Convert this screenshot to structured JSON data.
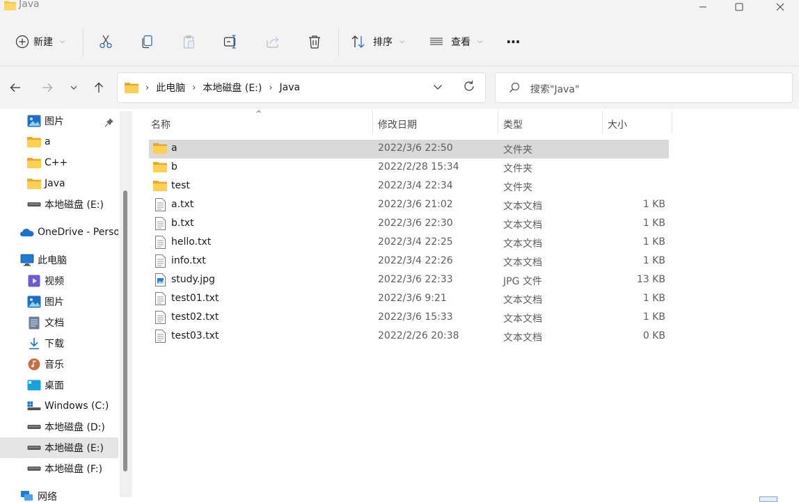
{
  "window": {
    "title": "Java"
  },
  "toolbar": {
    "new_label": "新建",
    "sort_label": "排序",
    "view_label": "查看",
    "more_label": "···"
  },
  "address": {
    "crumbs": [
      "此电脑",
      "本地磁盘 (E:)",
      "Java"
    ],
    "search_placeholder": "搜索\"Java\""
  },
  "sidebar": {
    "items": [
      {
        "label": "图片",
        "icon": "pictures-icon",
        "pinned": true
      },
      {
        "label": "a",
        "icon": "folder-icon"
      },
      {
        "label": "C++",
        "icon": "folder-icon"
      },
      {
        "label": "Java",
        "icon": "folder-icon"
      },
      {
        "label": "本地磁盘 (E:)",
        "icon": "drive-icon"
      },
      {
        "label": "OneDrive - Perso",
        "icon": "onedrive-icon"
      },
      {
        "label": "此电脑",
        "icon": "this-pc-icon"
      },
      {
        "label": "视频",
        "icon": "videos-icon"
      },
      {
        "label": "图片",
        "icon": "pictures-icon"
      },
      {
        "label": "文档",
        "icon": "documents-icon"
      },
      {
        "label": "下载",
        "icon": "downloads-icon"
      },
      {
        "label": "音乐",
        "icon": "music-icon"
      },
      {
        "label": "桌面",
        "icon": "desktop-icon"
      },
      {
        "label": "Windows (C:)",
        "icon": "windows-drive-icon"
      },
      {
        "label": "本地磁盘 (D:)",
        "icon": "drive-icon"
      },
      {
        "label": "本地磁盘 (E:)",
        "icon": "drive-icon",
        "selected": true
      },
      {
        "label": "本地磁盘 (F:)",
        "icon": "drive-icon"
      },
      {
        "label": "网络",
        "icon": "network-icon"
      }
    ]
  },
  "columns": {
    "name": "名称",
    "date": "修改日期",
    "type": "类型",
    "size": "大小"
  },
  "files": [
    {
      "name": "a",
      "date": "2022/3/6 22:50",
      "type": "文件夹",
      "size": "",
      "icon": "folder-icon",
      "selected": true
    },
    {
      "name": "b",
      "date": "2022/2/28 15:34",
      "type": "文件夹",
      "size": "",
      "icon": "folder-icon"
    },
    {
      "name": "test",
      "date": "2022/3/4 22:34",
      "type": "文件夹",
      "size": "",
      "icon": "folder-icon"
    },
    {
      "name": "a.txt",
      "date": "2022/3/6 21:02",
      "type": "文本文档",
      "size": "1 KB",
      "icon": "text-file-icon"
    },
    {
      "name": "b.txt",
      "date": "2022/3/6 22:30",
      "type": "文本文档",
      "size": "1 KB",
      "icon": "text-file-icon"
    },
    {
      "name": "hello.txt",
      "date": "2022/3/4 22:25",
      "type": "文本文档",
      "size": "1 KB",
      "icon": "text-file-icon"
    },
    {
      "name": "info.txt",
      "date": "2022/3/4 22:26",
      "type": "文本文档",
      "size": "1 KB",
      "icon": "text-file-icon"
    },
    {
      "name": "study.jpg",
      "date": "2022/3/6 22:33",
      "type": "JPG 文件",
      "size": "13 KB",
      "icon": "image-file-icon"
    },
    {
      "name": "test01.txt",
      "date": "2022/3/6 9:21",
      "type": "文本文档",
      "size": "1 KB",
      "icon": "text-file-icon"
    },
    {
      "name": "test02.txt",
      "date": "2022/3/6 15:33",
      "type": "文本文档",
      "size": "1 KB",
      "icon": "text-file-icon"
    },
    {
      "name": "test03.txt",
      "date": "2022/2/26 20:38",
      "type": "文本文档",
      "size": "0 KB",
      "icon": "text-file-icon"
    }
  ]
}
